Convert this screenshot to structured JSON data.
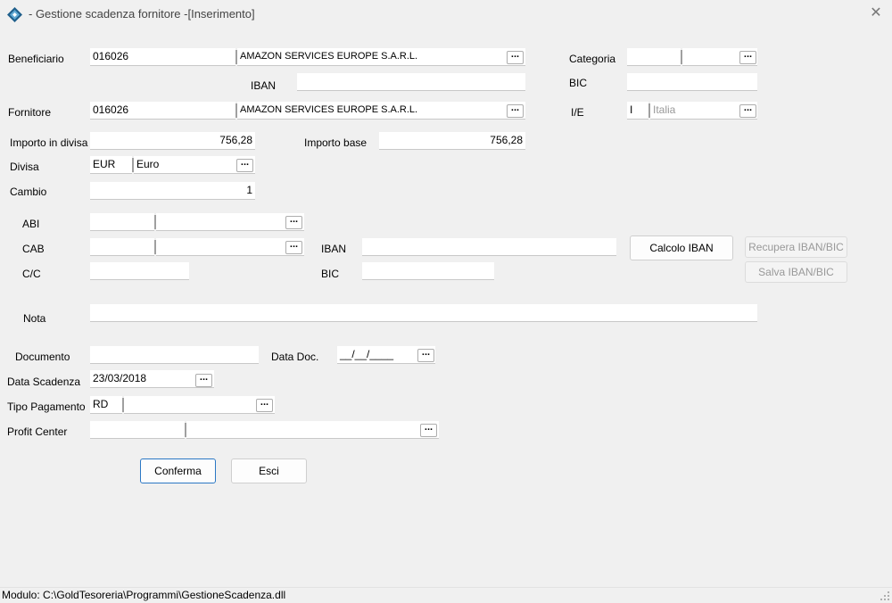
{
  "window": {
    "title": "- Gestione scadenza fornitore -[Inserimento]",
    "close_glyph": "✕"
  },
  "beneficiario": {
    "label": "Beneficiario",
    "code": "016026",
    "name": "AMAZON SERVICES EUROPE S.A.R.L.",
    "iban_label": "IBAN",
    "iban": "",
    "bic_label": "BIC",
    "bic": ""
  },
  "categoria": {
    "label": "Categoria",
    "code": "",
    "desc": ""
  },
  "fornitore": {
    "label": "Fornitore",
    "code": "016026",
    "name": "AMAZON SERVICES EUROPE S.A.R.L."
  },
  "ie": {
    "label": "I/E",
    "code": "I",
    "desc": "Italia"
  },
  "importi": {
    "divisa_label": "Importo in divisa",
    "divisa_value": "756,28",
    "base_label": "Importo base",
    "base_value": "756,28"
  },
  "divisa": {
    "label": "Divisa",
    "code": "EUR",
    "desc": "Euro"
  },
  "cambio": {
    "label": "Cambio",
    "value": "1"
  },
  "banca": {
    "abi_label": "ABI",
    "abi_code": "",
    "abi_desc": "",
    "cab_label": "CAB",
    "cab_code": "",
    "cab_desc": "",
    "cc_label": "C/C",
    "cc": "",
    "iban_label": "IBAN",
    "iban": "",
    "bic_label": "BIC",
    "bic": ""
  },
  "buttons": {
    "calcolo_iban": "Calcolo IBAN",
    "recupera": "Recupera IBAN/BIC",
    "salva": "Salva IBAN/BIC",
    "conferma": "Conferma",
    "esci": "Esci",
    "lookup": "..."
  },
  "nota": {
    "label": "Nota",
    "value": ""
  },
  "documento": {
    "label": "Documento",
    "value": "",
    "data_label": "Data Doc.",
    "data_value": "__/__/____"
  },
  "scadenza": {
    "label": "Data Scadenza",
    "value": "23/03/2018"
  },
  "pagamento": {
    "label": "Tipo Pagamento",
    "code": "RD",
    "desc": ""
  },
  "profit": {
    "label": "Profit Center",
    "code": "",
    "desc": ""
  },
  "status": {
    "text": "Modulo: C:\\GoldTesoreria\\Programmi\\GestioneScadenza.dll"
  },
  "colors": {
    "accent": "#1f5f8b",
    "primary_border": "#2b78c5"
  }
}
